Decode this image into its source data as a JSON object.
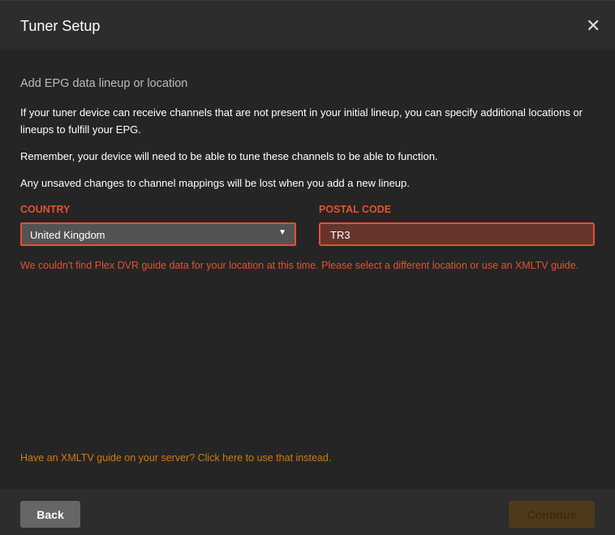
{
  "header": {
    "title": "Tuner Setup",
    "close_icon": "close-icon"
  },
  "body": {
    "subtitle": "Add EPG data lineup or location",
    "paragraphs": [
      "If your tuner device can receive channels that are not present in your initial lineup, you can specify additional locations or lineups to fulfill your EPG.",
      "Remember, your device will need to be able to tune these channels to be able to function.",
      "Any unsaved changes to channel mappings will be lost when you add a new lineup."
    ],
    "country_label": "COUNTRY",
    "country_value": "United Kingdom",
    "postal_label": "POSTAL CODE",
    "postal_value": "TR3",
    "error": "We couldn't find Plex DVR guide data for your location at this time. Please select a different location or use an XMLTV guide.",
    "xmltv_link": "Have an XMLTV guide on your server? Click here to use that instead."
  },
  "footer": {
    "back": "Back",
    "continue": "Continue"
  }
}
